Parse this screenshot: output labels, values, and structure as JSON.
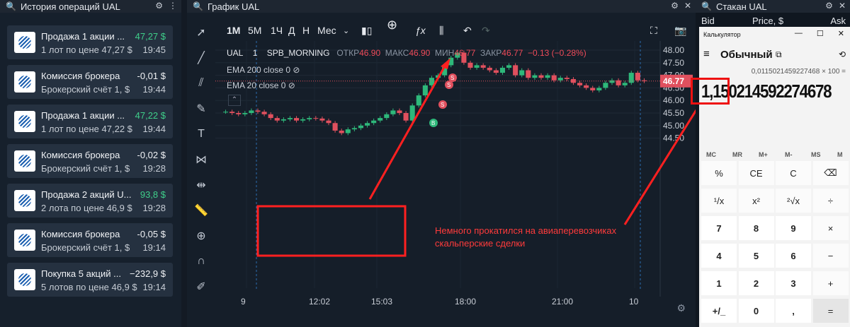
{
  "left_panel": {
    "title": "История операций UAL"
  },
  "operations": [
    {
      "title": "Продажа 1 акции ...",
      "amount": "47,27 $",
      "sub": "1 лот по цене 47,27 $",
      "time": "19:45",
      "color": "green"
    },
    {
      "title": "Комиссия брокера",
      "amount": "-0,01 $",
      "sub": "Брокерский счёт 1, $",
      "time": "19:44",
      "color": "white"
    },
    {
      "title": "Продажа 1 акции ...",
      "amount": "47,22 $",
      "sub": "1 лот по цене 47,22 $",
      "time": "19:44",
      "color": "green"
    },
    {
      "title": "Комиссия брокера",
      "amount": "-0,02 $",
      "sub": "Брокерский счёт 1, $",
      "time": "19:28",
      "color": "white"
    },
    {
      "title": "Продажа 2 акций U...",
      "amount": "93,8 $",
      "sub": "2 лота по цене 46,9 $",
      "time": "19:28",
      "color": "green"
    },
    {
      "title": "Комиссия брокера",
      "amount": "-0,05 $",
      "sub": "Брокерский счёт 1, $",
      "time": "19:14",
      "color": "white"
    },
    {
      "title": "Покупка 5 акций ...",
      "amount": "−232,9 $",
      "sub": "5 лотов по цене 46,9 $",
      "time": "19:14",
      "color": "white"
    }
  ],
  "chart_panel": {
    "title": "График UAL"
  },
  "timeframes": {
    "m1": "1М",
    "m5": "5М",
    "h1": "1Ч",
    "d": "Д",
    "w": "Н",
    "more": "Мес"
  },
  "legend": {
    "symbol": "UAL",
    "interval": "1",
    "session": "SPB_MORNING",
    "open_l": "ОТКР",
    "open": "46.90",
    "high_l": "МАКС",
    "high": "46.90",
    "low_l": "МИН",
    "low": "46.77",
    "close_l": "ЗАКР",
    "close": "46.77",
    "change": "−0.13 (−0.28%)",
    "ema200": "EMA 200 close 0",
    "ema20": "EMA 20 close 0"
  },
  "price_axis": [
    "48.00",
    "47.50",
    "47.00",
    "46.50",
    "46.00",
    "45.50",
    "45.00",
    "44.50"
  ],
  "current_price": "46.77",
  "time_axis": [
    "9",
    "12:02",
    "15:03",
    "18:00",
    "21:00",
    "10"
  ],
  "annotation": "Немного прокатился на авиаперевозчиках скальперские сделки",
  "markers": {
    "buy": "B",
    "sell": "S"
  },
  "orderbook": {
    "title": "Стакан UAL",
    "bid": "Bid",
    "price": "Price, $",
    "ask": "Ask"
  },
  "calculator": {
    "window_title": "Калькулятор",
    "mode": "Обычный",
    "expression": "0,0115021459227468 × 100 =",
    "display": "1,150214592274678",
    "memory": [
      "MC",
      "MR",
      "M+",
      "M-",
      "MS",
      "M"
    ],
    "keys": [
      [
        "%",
        "CE",
        "C",
        "⌫"
      ],
      [
        "¹/x",
        "x²",
        "²√x",
        "÷"
      ],
      [
        "7",
        "8",
        "9",
        "×"
      ],
      [
        "4",
        "5",
        "6",
        "−"
      ],
      [
        "1",
        "2",
        "3",
        "+"
      ],
      [
        "+/_",
        "0",
        ",",
        "="
      ]
    ]
  },
  "chart_data": {
    "type": "candlestick",
    "symbol": "UAL",
    "x_ticks": [
      "9",
      "12:02",
      "15:03",
      "18:00",
      "21:00",
      "10"
    ],
    "ylim": [
      44.3,
      48.1
    ],
    "ohlc_series_close": [
      45.55,
      45.5,
      45.45,
      45.5,
      45.6,
      45.55,
      45.45,
      45.3,
      45.2,
      45.25,
      45.3,
      45.2,
      45.25,
      45.3,
      45.28,
      45.2,
      45.1,
      44.8,
      44.7,
      44.85,
      44.9,
      45.0,
      45.1,
      45.2,
      45.3,
      45.45,
      45.6,
      45.5,
      45.2,
      45.8,
      46.2,
      46.6,
      46.9,
      47.0,
      47.4,
      47.7,
      47.9,
      47.5,
      47.3,
      47.4,
      47.3,
      47.2,
      47.1,
      47.3,
      47.4,
      47.0,
      47.2,
      46.9,
      47.0,
      46.9,
      47.0,
      46.8,
      46.9,
      46.85,
      46.7,
      46.6,
      46.5,
      46.4,
      46.5,
      46.7,
      46.8,
      46.6,
      46.7,
      47.1,
      46.8,
      46.77
    ],
    "last": 46.77
  }
}
